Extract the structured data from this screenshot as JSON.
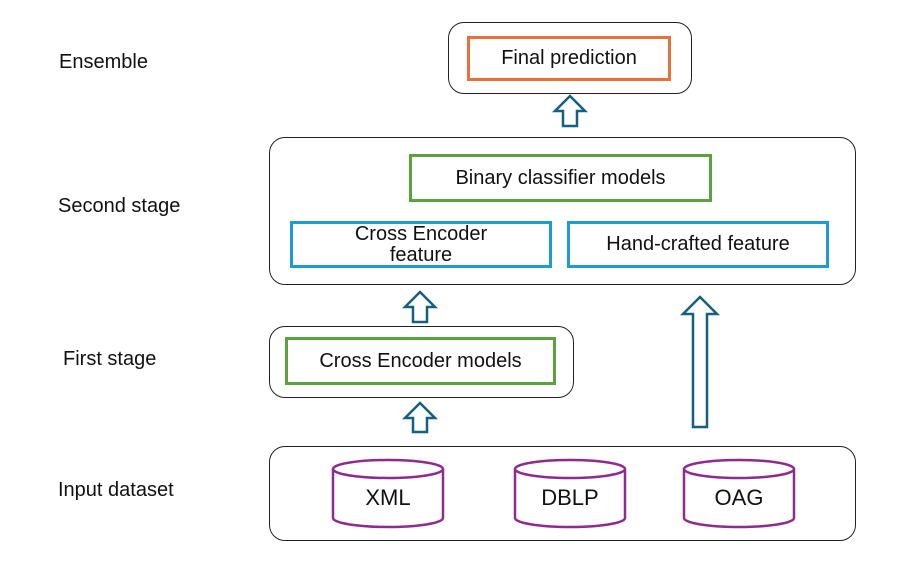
{
  "stages": {
    "ensemble": "Ensemble",
    "second_stage": "Second stage",
    "first_stage": "First stage",
    "input_dataset": "Input dataset"
  },
  "ensemble": {
    "final_prediction": "Final prediction"
  },
  "second_stage": {
    "binary_classifier": "Binary classifier models",
    "cross_encoder_feature_line1": "Cross Encoder",
    "cross_encoder_feature_line2": "feature",
    "hand_crafted_feature": "Hand-crafted feature"
  },
  "first_stage": {
    "cross_encoder_models": "Cross Encoder models"
  },
  "input_dataset": {
    "databases": [
      "XML",
      "DBLP",
      "OAG"
    ]
  },
  "colors": {
    "final_prediction_border": "#e8703a",
    "model_border": "#5ba13f",
    "feature_border": "#1f9bd4",
    "database_stroke": "#8e2b8e",
    "arrow_stroke": "#16607f"
  }
}
